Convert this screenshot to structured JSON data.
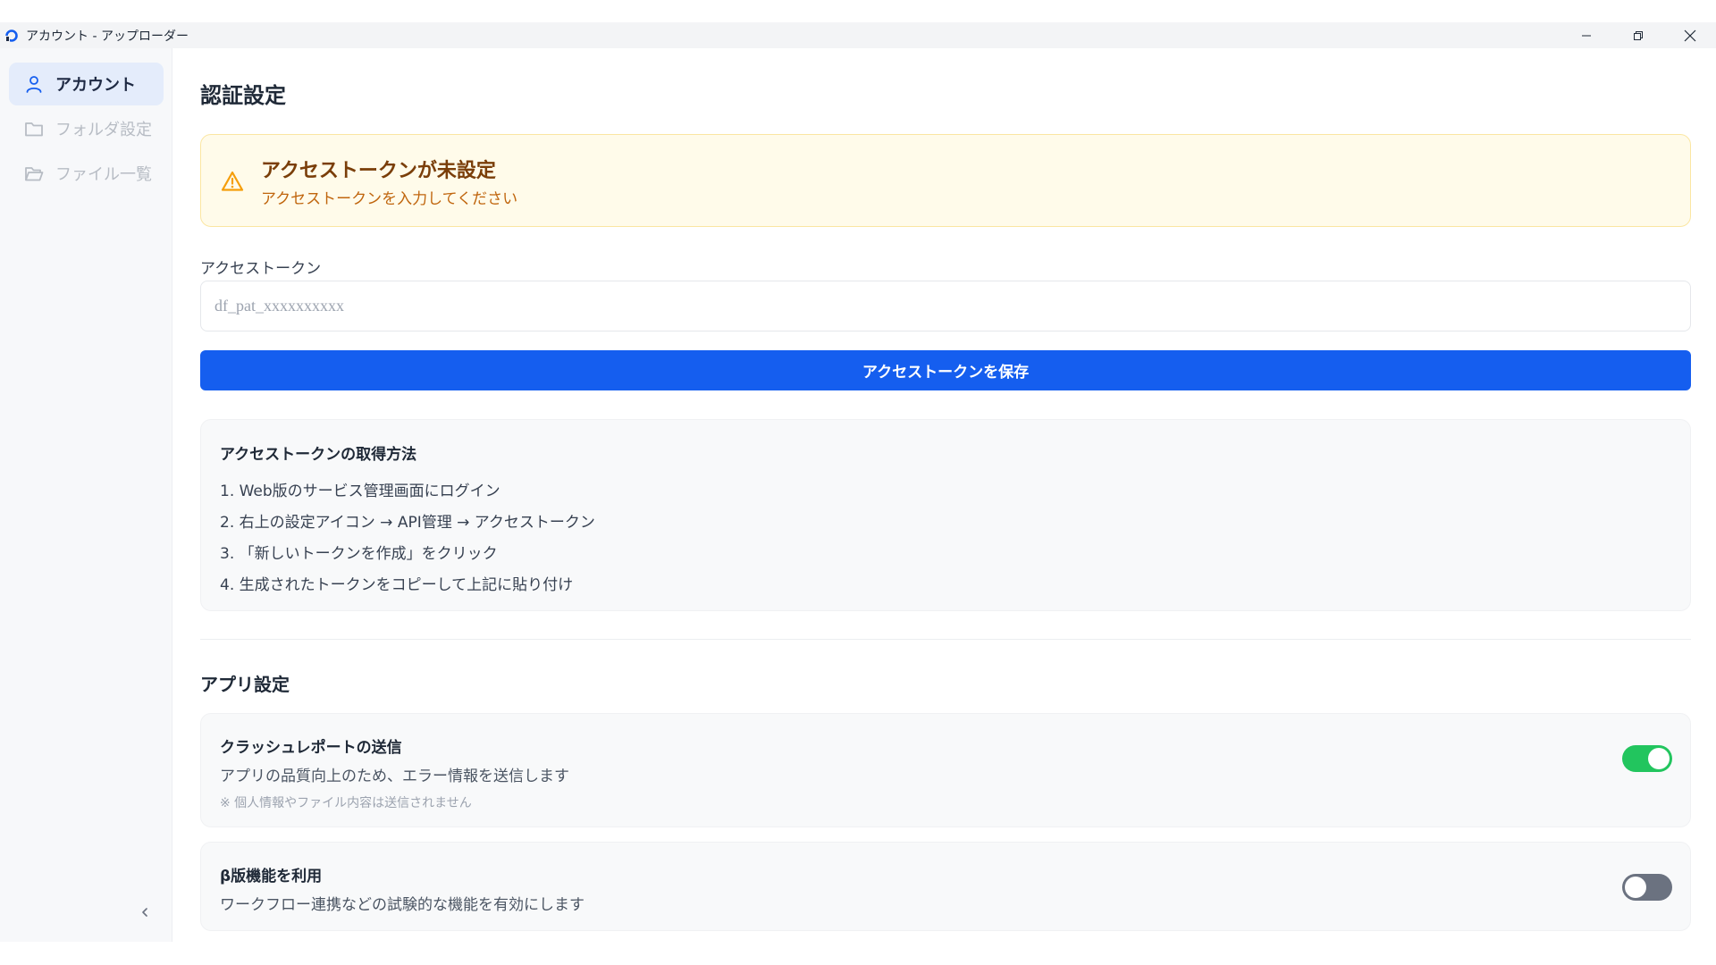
{
  "window": {
    "title": "アカウント - アップローダー"
  },
  "sidebar": {
    "items": [
      {
        "label": "アカウント",
        "icon": "user-icon",
        "active": true
      },
      {
        "label": "フォルダ設定",
        "icon": "folder-icon",
        "active": false
      },
      {
        "label": "ファイル一覧",
        "icon": "folder-open-icon",
        "active": false
      }
    ]
  },
  "auth": {
    "heading": "認証設定",
    "alert": {
      "title": "アクセストークンが未設定",
      "message": "アクセストークンを入力してください"
    },
    "token_label": "アクセストークン",
    "token_placeholder": "df_pat_xxxxxxxxxx",
    "token_value": "",
    "save_label": "アクセストークンを保存",
    "howto": {
      "title": "アクセストークンの取得方法",
      "steps": [
        "1. Web版のサービス管理画面にログイン",
        "2. 右上の設定アイコン → API管理 → アクセストークン",
        "3. 「新しいトークンを作成」をクリック",
        "4. 生成されたトークンをコピーして上記に貼り付け"
      ]
    }
  },
  "app_settings": {
    "heading": "アプリ設定",
    "crash_report": {
      "title": "クラッシュレポートの送信",
      "description": "アプリの品質向上のため、エラー情報を送信します",
      "note": "※ 個人情報やファイル内容は送信されません",
      "enabled": true
    },
    "beta": {
      "title": "β版機能を利用",
      "description": "ワークフロー連携などの試験的な機能を有効にします",
      "enabled": false
    }
  },
  "colors": {
    "primary": "#155eef",
    "warning_bg": "#fffbea",
    "warning_title": "#7a3e09",
    "warning_icon": "#f59e0b",
    "toggle_on": "#22c55e",
    "toggle_off": "#6b7280"
  }
}
